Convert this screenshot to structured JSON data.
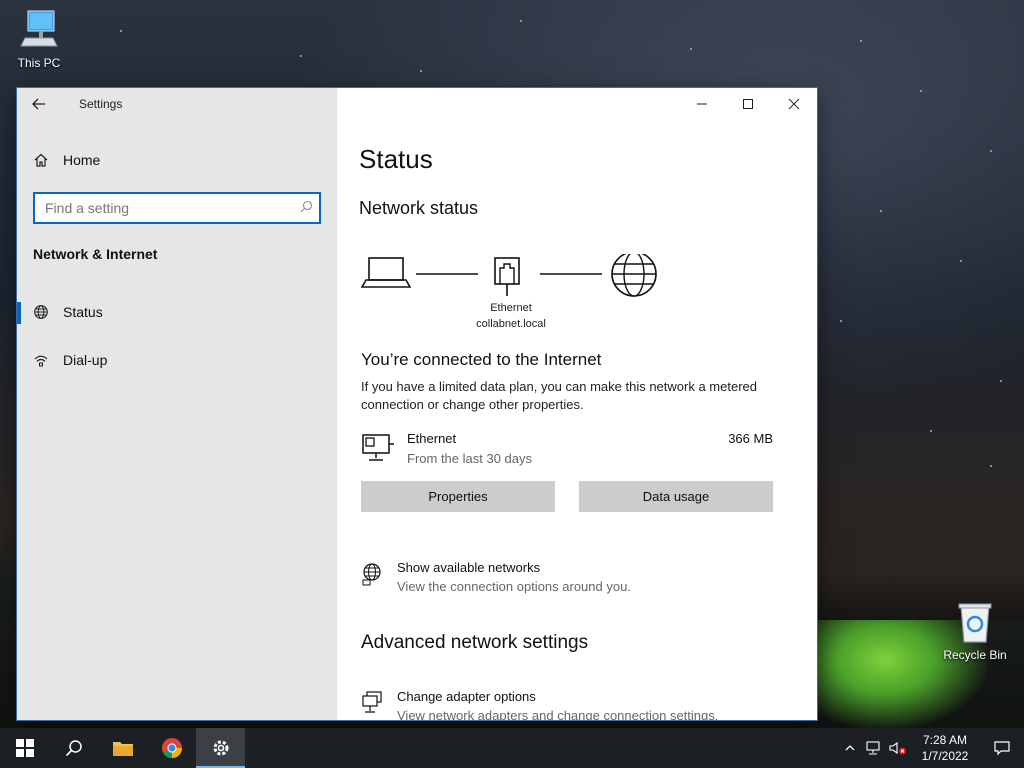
{
  "desktop": {
    "icons": [
      {
        "label": "This PC"
      },
      {
        "label": "Recycle Bin"
      }
    ]
  },
  "window": {
    "app_title": "Settings",
    "nav": {
      "home": "Home",
      "search_placeholder": "Find a setting",
      "section": "Network & Internet",
      "items": [
        {
          "label": "Status",
          "icon": "globe-icon",
          "active": true
        },
        {
          "label": "Dial-up",
          "icon": "dial-up-icon",
          "active": false
        }
      ]
    },
    "content": {
      "title": "Status",
      "network_status_heading": "Network status",
      "diagram": {
        "adapter_label": "Ethernet",
        "domain_label": "collabnet.local"
      },
      "connected_heading": "You’re connected to the Internet",
      "connected_desc": "If you have a limited data plan, you can make this network a metered connection or change other properties.",
      "connection": {
        "name": "Ethernet",
        "period": "From the last 30 days",
        "usage": "366 MB"
      },
      "buttons": {
        "properties": "Properties",
        "data_usage": "Data usage"
      },
      "show_networks": {
        "title": "Show available networks",
        "subtitle": "View the connection options around you."
      },
      "advanced_heading": "Advanced network settings",
      "adapter_options": {
        "title": "Change adapter options",
        "subtitle": "View network adapters and change connection settings."
      }
    }
  },
  "taskbar": {
    "time": "7:28 AM",
    "date": "1/7/2022",
    "pinned": [
      "start-icon",
      "search-icon",
      "file-explorer-icon",
      "chrome-icon",
      "settings-icon"
    ]
  },
  "colors": {
    "accent": "#0a64c8",
    "nav_bg": "#e6e6e6",
    "button_bg": "#cccccc",
    "taskbar_bg": "#1c1f24"
  }
}
